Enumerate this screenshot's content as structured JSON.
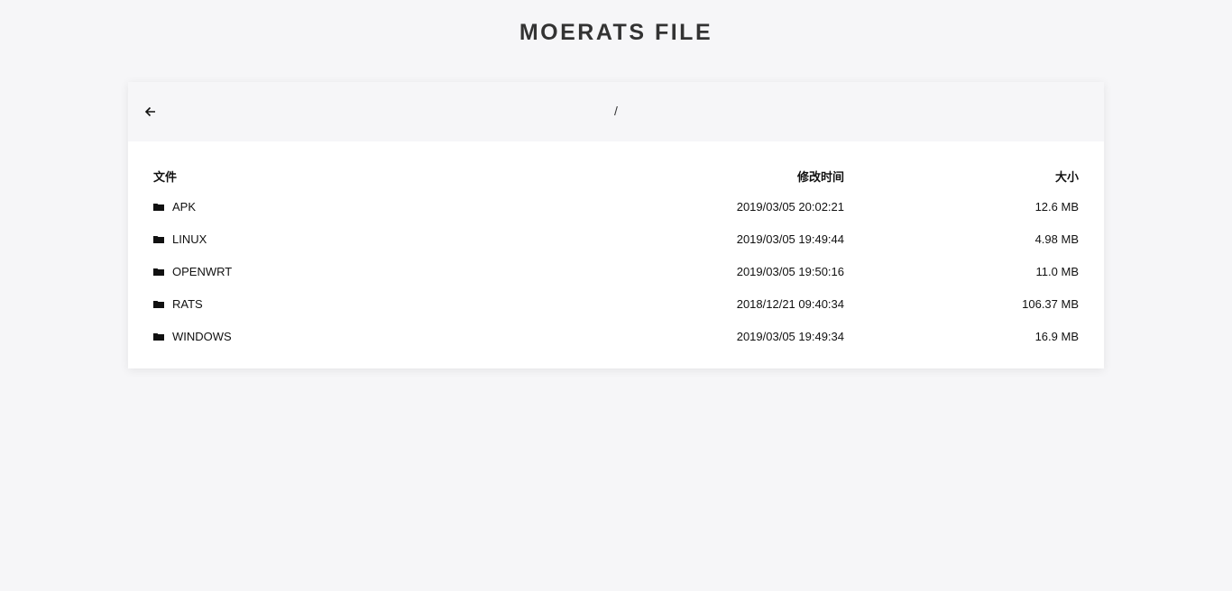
{
  "title": "MOERATS FILE",
  "path": "/",
  "columns": {
    "name": "文件",
    "modified": "修改时间",
    "size": "大小"
  },
  "rows": [
    {
      "name": "APK",
      "modified": "2019/03/05 20:02:21",
      "size": "12.6 MB"
    },
    {
      "name": "LINUX",
      "modified": "2019/03/05 19:49:44",
      "size": "4.98 MB"
    },
    {
      "name": "OPENWRT",
      "modified": "2019/03/05 19:50:16",
      "size": "11.0 MB"
    },
    {
      "name": "RATS",
      "modified": "2018/12/21 09:40:34",
      "size": "106.37 MB"
    },
    {
      "name": "WINDOWS",
      "modified": "2019/03/05 19:49:34",
      "size": "16.9 MB"
    }
  ]
}
